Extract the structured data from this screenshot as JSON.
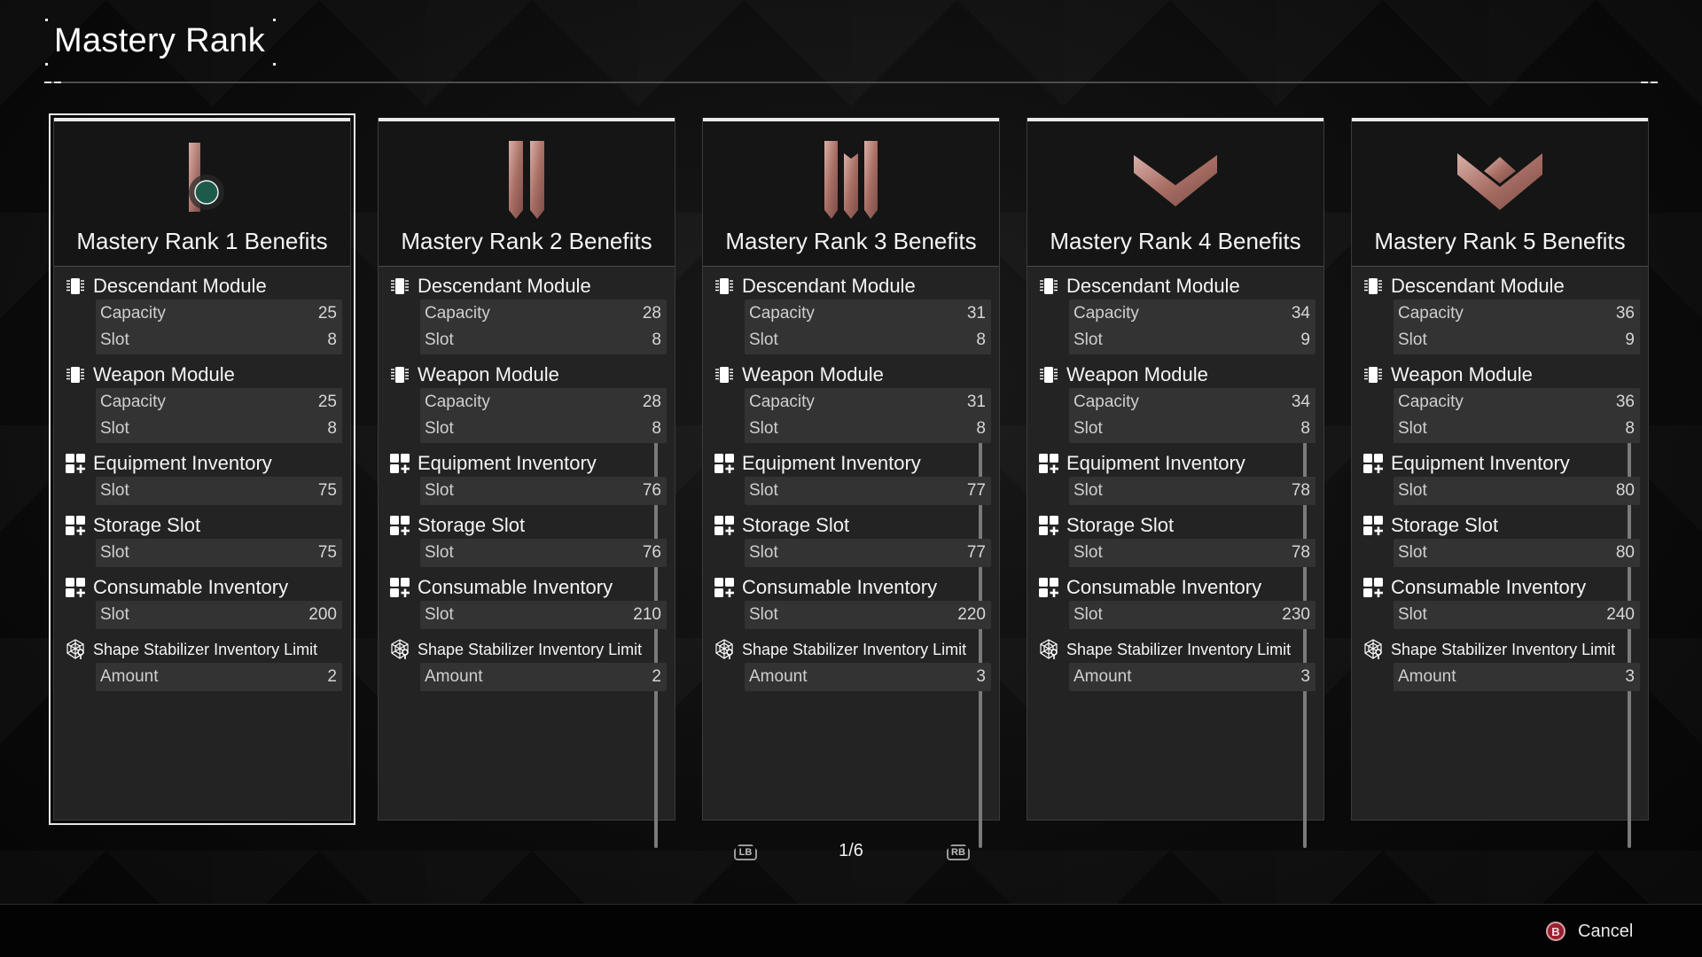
{
  "header": {
    "title": "Mastery Rank"
  },
  "cards": [
    {
      "title": "Mastery Rank 1 Benefits",
      "rank_icon": "rank-1-emblem",
      "selected": true,
      "has_scrollbar": false,
      "sections": [
        {
          "label": "Descendant Module",
          "icon": "module-chip-icon",
          "rows": [
            {
              "label": "Capacity",
              "value": "25"
            },
            {
              "label": "Slot",
              "value": "8"
            }
          ]
        },
        {
          "label": "Weapon Module",
          "icon": "module-chip-icon",
          "rows": [
            {
              "label": "Capacity",
              "value": "25"
            },
            {
              "label": "Slot",
              "value": "8"
            }
          ]
        },
        {
          "label": "Equipment Inventory",
          "icon": "inventory-grid-plus-icon",
          "rows": [
            {
              "label": "Slot",
              "value": "75"
            }
          ]
        },
        {
          "label": "Storage Slot",
          "icon": "inventory-grid-plus-icon",
          "rows": [
            {
              "label": "Slot",
              "value": "75"
            }
          ]
        },
        {
          "label": "Consumable Inventory",
          "icon": "inventory-grid-plus-icon",
          "rows": [
            {
              "label": "Slot",
              "value": "200"
            }
          ]
        },
        {
          "label": "Shape Stabilizer Inventory Limit",
          "icon": "shape-stabilizer-icon",
          "rows": [
            {
              "label": "Amount",
              "value": "2"
            }
          ]
        }
      ]
    },
    {
      "title": "Mastery Rank 2 Benefits",
      "rank_icon": "rank-2-emblem",
      "selected": false,
      "has_scrollbar": true,
      "sections": [
        {
          "label": "Descendant Module",
          "icon": "module-chip-icon",
          "rows": [
            {
              "label": "Capacity",
              "value": "28"
            },
            {
              "label": "Slot",
              "value": "8"
            }
          ]
        },
        {
          "label": "Weapon Module",
          "icon": "module-chip-icon",
          "rows": [
            {
              "label": "Capacity",
              "value": "28"
            },
            {
              "label": "Slot",
              "value": "8"
            }
          ]
        },
        {
          "label": "Equipment Inventory",
          "icon": "inventory-grid-plus-icon",
          "rows": [
            {
              "label": "Slot",
              "value": "76"
            }
          ]
        },
        {
          "label": "Storage Slot",
          "icon": "inventory-grid-plus-icon",
          "rows": [
            {
              "label": "Slot",
              "value": "76"
            }
          ]
        },
        {
          "label": "Consumable Inventory",
          "icon": "inventory-grid-plus-icon",
          "rows": [
            {
              "label": "Slot",
              "value": "210"
            }
          ]
        },
        {
          "label": "Shape Stabilizer Inventory Limit",
          "icon": "shape-stabilizer-icon",
          "rows": [
            {
              "label": "Amount",
              "value": "2"
            }
          ]
        }
      ]
    },
    {
      "title": "Mastery Rank 3 Benefits",
      "rank_icon": "rank-3-emblem",
      "selected": false,
      "has_scrollbar": true,
      "sections": [
        {
          "label": "Descendant Module",
          "icon": "module-chip-icon",
          "rows": [
            {
              "label": "Capacity",
              "value": "31"
            },
            {
              "label": "Slot",
              "value": "8"
            }
          ]
        },
        {
          "label": "Weapon Module",
          "icon": "module-chip-icon",
          "rows": [
            {
              "label": "Capacity",
              "value": "31"
            },
            {
              "label": "Slot",
              "value": "8"
            }
          ]
        },
        {
          "label": "Equipment Inventory",
          "icon": "inventory-grid-plus-icon",
          "rows": [
            {
              "label": "Slot",
              "value": "77"
            }
          ]
        },
        {
          "label": "Storage Slot",
          "icon": "inventory-grid-plus-icon",
          "rows": [
            {
              "label": "Slot",
              "value": "77"
            }
          ]
        },
        {
          "label": "Consumable Inventory",
          "icon": "inventory-grid-plus-icon",
          "rows": [
            {
              "label": "Slot",
              "value": "220"
            }
          ]
        },
        {
          "label": "Shape Stabilizer Inventory Limit",
          "icon": "shape-stabilizer-icon",
          "rows": [
            {
              "label": "Amount",
              "value": "3"
            }
          ]
        }
      ]
    },
    {
      "title": "Mastery Rank 4 Benefits",
      "rank_icon": "rank-4-emblem",
      "selected": false,
      "has_scrollbar": true,
      "sections": [
        {
          "label": "Descendant Module",
          "icon": "module-chip-icon",
          "rows": [
            {
              "label": "Capacity",
              "value": "34"
            },
            {
              "label": "Slot",
              "value": "9"
            }
          ]
        },
        {
          "label": "Weapon Module",
          "icon": "module-chip-icon",
          "rows": [
            {
              "label": "Capacity",
              "value": "34"
            },
            {
              "label": "Slot",
              "value": "8"
            }
          ]
        },
        {
          "label": "Equipment Inventory",
          "icon": "inventory-grid-plus-icon",
          "rows": [
            {
              "label": "Slot",
              "value": "78"
            }
          ]
        },
        {
          "label": "Storage Slot",
          "icon": "inventory-grid-plus-icon",
          "rows": [
            {
              "label": "Slot",
              "value": "78"
            }
          ]
        },
        {
          "label": "Consumable Inventory",
          "icon": "inventory-grid-plus-icon",
          "rows": [
            {
              "label": "Slot",
              "value": "230"
            }
          ]
        },
        {
          "label": "Shape Stabilizer Inventory Limit",
          "icon": "shape-stabilizer-icon",
          "rows": [
            {
              "label": "Amount",
              "value": "3"
            }
          ]
        }
      ]
    },
    {
      "title": "Mastery Rank 5 Benefits",
      "rank_icon": "rank-5-emblem",
      "selected": false,
      "has_scrollbar": true,
      "sections": [
        {
          "label": "Descendant Module",
          "icon": "module-chip-icon",
          "rows": [
            {
              "label": "Capacity",
              "value": "36"
            },
            {
              "label": "Slot",
              "value": "9"
            }
          ]
        },
        {
          "label": "Weapon Module",
          "icon": "module-chip-icon",
          "rows": [
            {
              "label": "Capacity",
              "value": "36"
            },
            {
              "label": "Slot",
              "value": "8"
            }
          ]
        },
        {
          "label": "Equipment Inventory",
          "icon": "inventory-grid-plus-icon",
          "rows": [
            {
              "label": "Slot",
              "value": "80"
            }
          ]
        },
        {
          "label": "Storage Slot",
          "icon": "inventory-grid-plus-icon",
          "rows": [
            {
              "label": "Slot",
              "value": "80"
            }
          ]
        },
        {
          "label": "Consumable Inventory",
          "icon": "inventory-grid-plus-icon",
          "rows": [
            {
              "label": "Slot",
              "value": "240"
            }
          ]
        },
        {
          "label": "Shape Stabilizer Inventory Limit",
          "icon": "shape-stabilizer-icon",
          "rows": [
            {
              "label": "Amount",
              "value": "3"
            }
          ]
        }
      ]
    }
  ],
  "pager": {
    "prev_button": "LB",
    "next_button": "RB",
    "current": 1,
    "total": 6,
    "label": "1/6"
  },
  "footer": {
    "cancel_button_glyph": "B",
    "cancel_label": "Cancel"
  },
  "colors": {
    "accent_rank": "#b07a70",
    "rank1_gem": "#1e5a4a",
    "cancel_button": "#9c1f2e"
  }
}
